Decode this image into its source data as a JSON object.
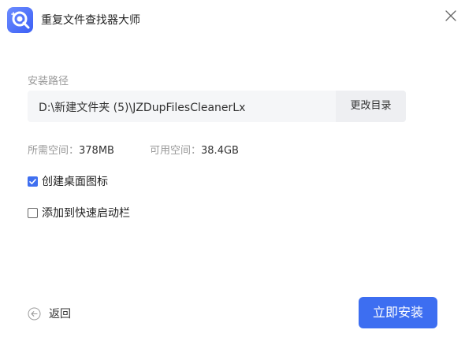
{
  "window": {
    "title": "重复文件查找器大师",
    "logo_icon": "search-magnifier-logo-icon",
    "close_icon": "close-icon"
  },
  "install": {
    "path_label": "安装路径",
    "path_value": "D:\\新建文件夹 (5)\\JZDupFilesCleanerLx",
    "change_dir_label": "更改目录",
    "space_required_label": "所需空间：",
    "space_required_value": "378MB",
    "space_available_label": "可用空间：",
    "space_available_value": "38.4GB"
  },
  "options": [
    {
      "label": "创建桌面图标",
      "checked": true
    },
    {
      "label": "添加到快速启动栏",
      "checked": false
    }
  ],
  "footer": {
    "back_label": "返回",
    "install_label": "立即安装"
  },
  "colors": {
    "accent": "#3d6ef1",
    "muted_text": "#999999",
    "input_bg": "#f5f6f8"
  }
}
